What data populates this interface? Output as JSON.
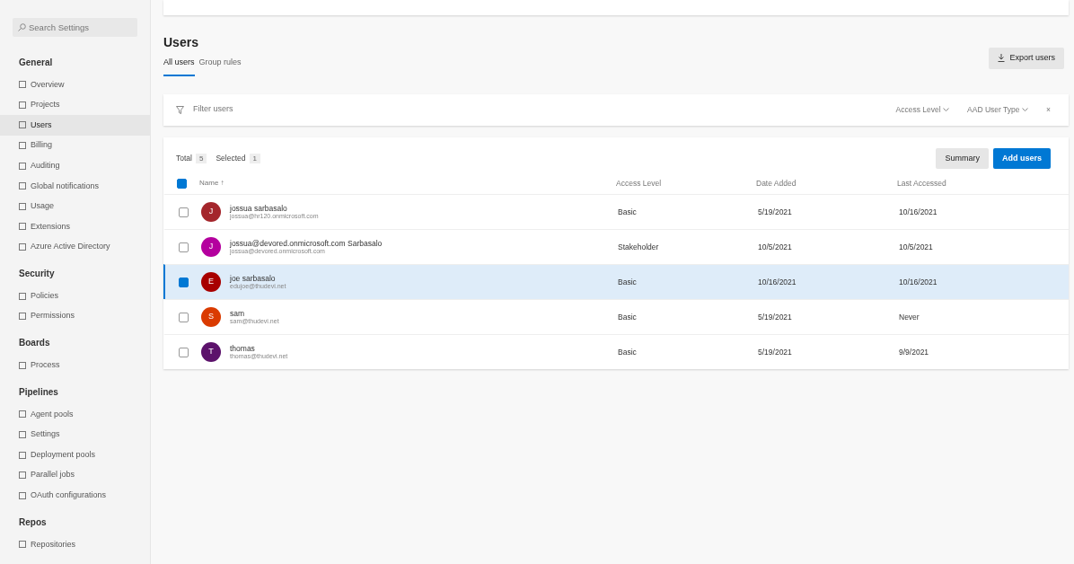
{
  "sidebar": {
    "search": {
      "placeholder": "Search Settings"
    },
    "sections": [
      {
        "title": "General",
        "items": [
          {
            "label": "Overview",
            "selected": false
          },
          {
            "label": "Projects",
            "selected": false
          },
          {
            "label": "Users",
            "selected": true
          },
          {
            "label": "Billing",
            "selected": false
          },
          {
            "label": "Auditing",
            "selected": false
          },
          {
            "label": "Global notifications",
            "selected": false
          },
          {
            "label": "Usage",
            "selected": false
          },
          {
            "label": "Extensions",
            "selected": false
          },
          {
            "label": "Azure Active Directory",
            "selected": false
          }
        ]
      },
      {
        "title": "Security",
        "items": [
          {
            "label": "Policies",
            "selected": false
          },
          {
            "label": "Permissions",
            "selected": false
          }
        ]
      },
      {
        "title": "Boards",
        "items": [
          {
            "label": "Process",
            "selected": false
          }
        ]
      },
      {
        "title": "Pipelines",
        "items": [
          {
            "label": "Agent pools",
            "selected": false
          },
          {
            "label": "Settings",
            "selected": false
          },
          {
            "label": "Deployment pools",
            "selected": false
          },
          {
            "label": "Parallel jobs",
            "selected": false
          },
          {
            "label": "OAuth configurations",
            "selected": false
          }
        ]
      },
      {
        "title": "Repos",
        "items": [
          {
            "label": "Repositories",
            "selected": false
          }
        ]
      }
    ]
  },
  "page": {
    "title": "Users",
    "tabs": [
      {
        "label": "All users",
        "selected": true
      },
      {
        "label": "Group rules",
        "selected": false
      }
    ],
    "export_button": "Export users"
  },
  "filter": {
    "placeholder": "Filter users",
    "dropdowns": [
      "Access Level",
      "AAD User Type"
    ],
    "clear": "×"
  },
  "table": {
    "total_label": "Total",
    "total": "5",
    "selected_label": "Selected",
    "selected_count": "1",
    "buttons": [
      "Summary",
      "Add users"
    ],
    "all_checked": true,
    "columns": [
      "Name ↑",
      "Access Level",
      "Date Added",
      "Last Accessed"
    ],
    "rows": [
      {
        "initial": "J",
        "color": "#a4262c",
        "name": "jossua sarbasalo",
        "email": "jossua@hr120.onmicrosoft.com",
        "access": "Basic",
        "added": "5/19/2021",
        "accessed": "10/16/2021",
        "selected": false
      },
      {
        "initial": "J",
        "color": "#b4009e",
        "name": "jossua@devored.onmicrosoft.com Sarbasalo",
        "email": "jossua@devored.onmicrosoft.com",
        "access": "Stakeholder",
        "added": "10/5/2021",
        "accessed": "10/5/2021",
        "selected": false
      },
      {
        "initial": "E",
        "color": "#a80000",
        "name": "joe sarbasalo",
        "email": "edujoe@thudevi.net",
        "access": "Basic",
        "added": "10/16/2021",
        "accessed": "10/16/2021",
        "selected": true
      },
      {
        "initial": "S",
        "color": "#da3b01",
        "name": "sam",
        "email": "sam@thudevi.net",
        "access": "Basic",
        "added": "5/19/2021",
        "accessed": "Never",
        "selected": false
      },
      {
        "initial": "T",
        "color": "#5c126b",
        "name": "thomas",
        "email": "thomas@thudevi.net",
        "access": "Basic",
        "added": "5/19/2021",
        "accessed": "9/9/2021",
        "selected": false
      }
    ]
  }
}
